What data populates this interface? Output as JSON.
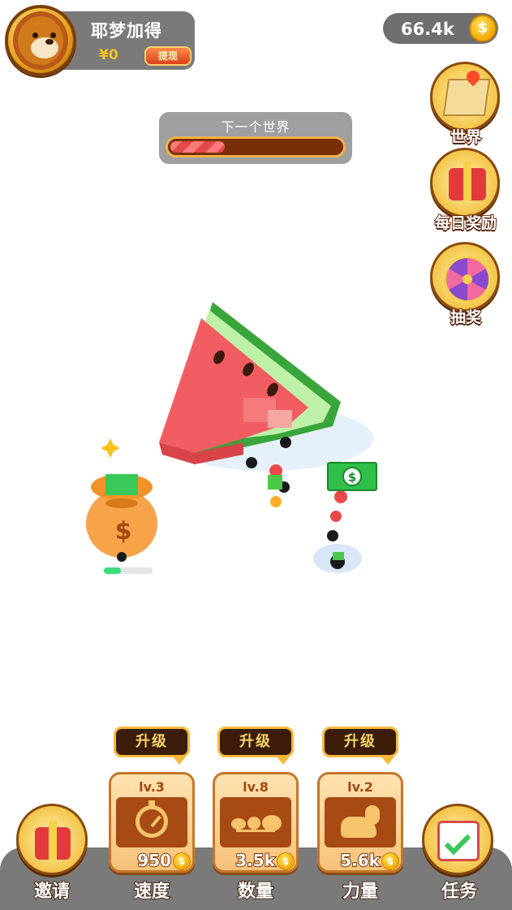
{
  "profile": {
    "username": "耶梦加得",
    "balance": "¥0",
    "withdraw_label": "提现",
    "avatar_icon": "lion-avatar-icon"
  },
  "coins": {
    "value": "66.4k",
    "coin_symbol": "$"
  },
  "next_world": {
    "title": "下一个世界",
    "progress_fraction": 0.32
  },
  "side_buttons": [
    {
      "label": "世界",
      "icon": "map-icon"
    },
    {
      "label": "每日奖励",
      "icon": "gift-box-icon"
    },
    {
      "label": "抽奖",
      "icon": "prize-wheel-icon"
    }
  ],
  "scene": {
    "money_bag_symbol": "$",
    "money_bag_progress_fraction": 0.35,
    "cash_symbol": "$"
  },
  "upgrades": [
    {
      "tip": "升级",
      "level": "lv.3",
      "cost": "950",
      "label": "速度",
      "icon": "stopwatch-icon"
    },
    {
      "tip": "升级",
      "level": "lv.8",
      "cost": "3.5k",
      "label": "数量",
      "icon": "ant-icon"
    },
    {
      "tip": "升级",
      "level": "lv.2",
      "cost": "5.6k",
      "label": "力量",
      "icon": "muscle-arm-icon"
    }
  ],
  "bottom_nav": {
    "invite_label": "邀请",
    "task_label": "任务"
  },
  "colors": {
    "accent_gold": "#f6c21b",
    "progress_red": "#e24a4a",
    "card_brown": "#a84a14"
  }
}
